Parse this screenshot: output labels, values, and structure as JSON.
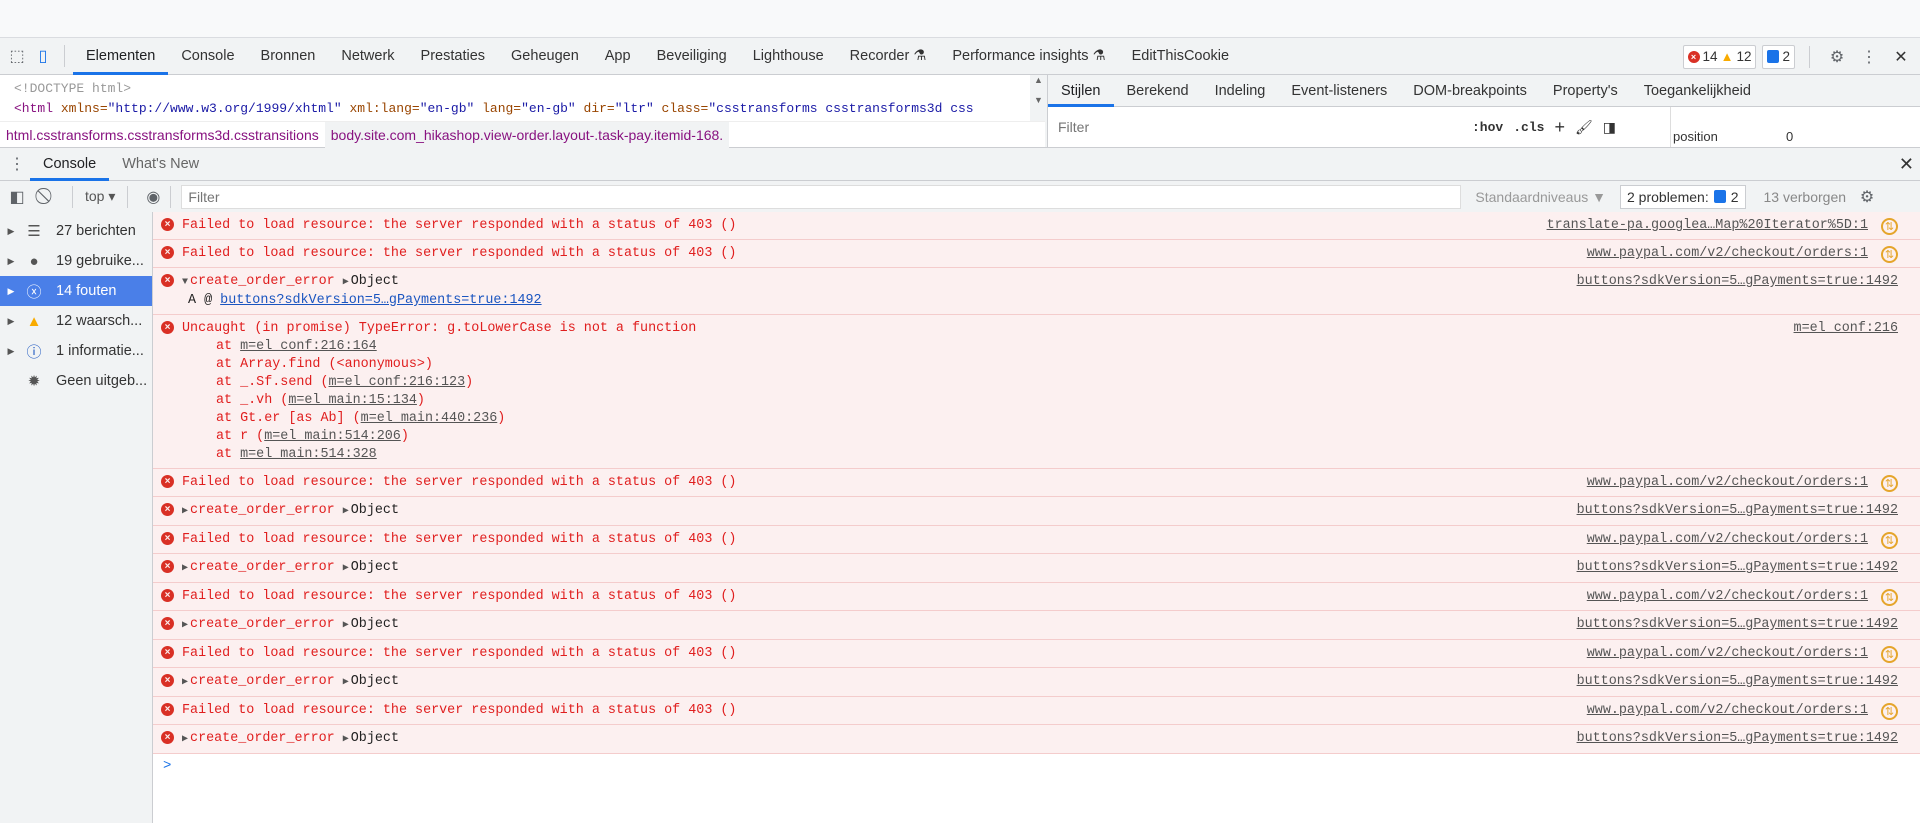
{
  "devtools_tabs": [
    "Elementen",
    "Console",
    "Bronnen",
    "Netwerk",
    "Prestaties",
    "Geheugen",
    "App",
    "Beveiliging",
    "Lighthouse",
    "Recorder ⚗",
    "Performance insights ⚗",
    "EditThisCookie"
  ],
  "counters": {
    "errors": "14",
    "warnings": "12",
    "issues": "2"
  },
  "dom": {
    "doctype": "<!DOCTYPE html>",
    "tag": "<html",
    "a1": " xmlns=",
    "v1": "\"http://www.w3.org/1999/xhtml\"",
    "a2": " xml:lang=",
    "v2": "\"en-gb\"",
    "a3": " lang=",
    "v3": "\"en-gb\"",
    "a4": " dir=",
    "v4": "\"ltr\"",
    "a5": " class=",
    "v5": "\"csstransforms csstransforms3d css"
  },
  "breadcrumb": [
    "html.csstransforms.csstransforms3d.csstransitions",
    "body.site.com_hikashop.view-order.layout-.task-pay.itemid-168."
  ],
  "styles_tabs": [
    "Stijlen",
    "Berekend",
    "Indeling",
    "Event-listeners",
    "DOM-breakpoints",
    "Property's",
    "Toegankelijkheid"
  ],
  "styles_filter": {
    "placeholder": "Filter",
    "hov": ":hov",
    "cls": ".cls"
  },
  "computed": {
    "label": "position",
    "value": "0"
  },
  "drawer_tabs": [
    "Console",
    "What's New"
  ],
  "console_toolbar": {
    "context": "top",
    "filter_placeholder": "Filter",
    "levels": "Standaardniveaus ▼",
    "problems": "2 problemen:",
    "problems_count": "2",
    "hidden": "13 verborgen"
  },
  "sidebar": [
    {
      "label": "27 berichten",
      "icon": "list-icon"
    },
    {
      "label": "19 gebruike...",
      "icon": "user-icon"
    },
    {
      "label": "14 fouten",
      "icon": "error-icon",
      "active": true
    },
    {
      "label": "12 waarsch...",
      "icon": "warning-icon"
    },
    {
      "label": "1 informatie...",
      "icon": "info-icon"
    },
    {
      "label": "Geen uitgeb...",
      "icon": "bug-icon"
    }
  ],
  "messages": [
    {
      "type": "net",
      "text": "Failed to load resource: the server responded with a status of 403 ()",
      "src": "translate-pa.googlea…Map%20Iterator%5D:1"
    },
    {
      "type": "net",
      "text": "Failed to load resource: the server responded with a status of 403 ()",
      "src": "www.paypal.com/v2/checkout/orders:1"
    },
    {
      "type": "obj",
      "expanded": true,
      "text": "create_order_error",
      "obj": "Object",
      "src": "buttons?sdkVersion=5…gPayments=true:1492",
      "sub_prefix": "A @ ",
      "sub_link": "buttons?sdkVersion=5…gPayments=true:1492"
    },
    {
      "type": "stack",
      "text": "Uncaught (in promise) TypeError: g.toLowerCase is not a function",
      "src": "m=el_conf:216",
      "stack": [
        [
          "at ",
          "m=el_conf:216:164",
          ""
        ],
        [
          "at Array.find (<anonymous>)",
          "",
          ""
        ],
        [
          "at _.Sf.send (",
          "m=el_conf:216:123",
          ")"
        ],
        [
          "at _.vh (",
          "m=el_main:15:134",
          ")"
        ],
        [
          "at Gt.er [as Ab] (",
          "m=el_main:440:236",
          ")"
        ],
        [
          "at r (",
          "m=el_main:514:206",
          ")"
        ],
        [
          "at ",
          "m=el_main:514:328",
          ""
        ]
      ]
    },
    {
      "type": "net",
      "text": "Failed to load resource: the server responded with a status of 403 ()",
      "src": "www.paypal.com/v2/checkout/orders:1"
    },
    {
      "type": "obj",
      "text": "create_order_error",
      "obj": "Object",
      "src": "buttons?sdkVersion=5…gPayments=true:1492"
    },
    {
      "type": "net",
      "text": "Failed to load resource: the server responded with a status of 403 ()",
      "src": "www.paypal.com/v2/checkout/orders:1"
    },
    {
      "type": "obj",
      "text": "create_order_error",
      "obj": "Object",
      "src": "buttons?sdkVersion=5…gPayments=true:1492"
    },
    {
      "type": "net",
      "text": "Failed to load resource: the server responded with a status of 403 ()",
      "src": "www.paypal.com/v2/checkout/orders:1"
    },
    {
      "type": "obj",
      "text": "create_order_error",
      "obj": "Object",
      "src": "buttons?sdkVersion=5…gPayments=true:1492"
    },
    {
      "type": "net",
      "text": "Failed to load resource: the server responded with a status of 403 ()",
      "src": "www.paypal.com/v2/checkout/orders:1"
    },
    {
      "type": "obj",
      "text": "create_order_error",
      "obj": "Object",
      "src": "buttons?sdkVersion=5…gPayments=true:1492"
    },
    {
      "type": "net",
      "text": "Failed to load resource: the server responded with a status of 403 ()",
      "src": "www.paypal.com/v2/checkout/orders:1"
    },
    {
      "type": "obj",
      "text": "create_order_error",
      "obj": "Object",
      "src": "buttons?sdkVersion=5…gPayments=true:1492"
    }
  ],
  "prompt": ">"
}
